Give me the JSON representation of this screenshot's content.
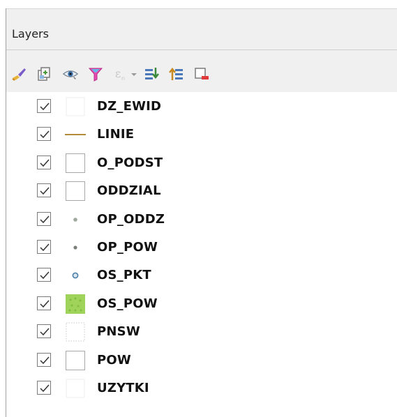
{
  "panel": {
    "title": "Layers"
  },
  "toolbar": {
    "tools": [
      {
        "icon": "style-brush-icon",
        "enabled": true
      },
      {
        "icon": "add-group-icon",
        "enabled": true
      },
      {
        "icon": "visibility-eye-icon",
        "enabled": true
      },
      {
        "icon": "filter-funnel-icon",
        "enabled": true
      },
      {
        "icon": "expression-filter-icon",
        "enabled": false
      },
      {
        "icon": "dropdown-arrow-icon",
        "enabled": false
      },
      {
        "icon": "expand-all-icon",
        "enabled": true
      },
      {
        "icon": "collapse-all-icon",
        "enabled": true
      },
      {
        "icon": "remove-layer-icon",
        "enabled": true
      }
    ]
  },
  "layers": [
    {
      "name": "DZ_EWID",
      "checked": true,
      "symbol": "polygon-faint"
    },
    {
      "name": "LINIE",
      "checked": true,
      "symbol": "line"
    },
    {
      "name": "O_PODST",
      "checked": true,
      "symbol": "polygon"
    },
    {
      "name": "ODDZIAL",
      "checked": true,
      "symbol": "polygon"
    },
    {
      "name": "OP_ODDZ",
      "checked": true,
      "symbol": "point-light"
    },
    {
      "name": "OP_POW",
      "checked": true,
      "symbol": "point-dark"
    },
    {
      "name": "OS_PKT",
      "checked": true,
      "symbol": "point-ring"
    },
    {
      "name": "OS_POW",
      "checked": true,
      "symbol": "polygon-green"
    },
    {
      "name": "PNSW",
      "checked": true,
      "symbol": "polygon-dotted"
    },
    {
      "name": "POW",
      "checked": true,
      "symbol": "polygon"
    },
    {
      "name": "UZYTKI",
      "checked": true,
      "symbol": "polygon-faint"
    }
  ],
  "colors": {
    "line_symbol": "#b5893a",
    "point_light": "#a0a8a0",
    "point_dark": "#7a7f7a",
    "point_ring": "#4a7ea8",
    "green_fill": "#9fd35a"
  }
}
